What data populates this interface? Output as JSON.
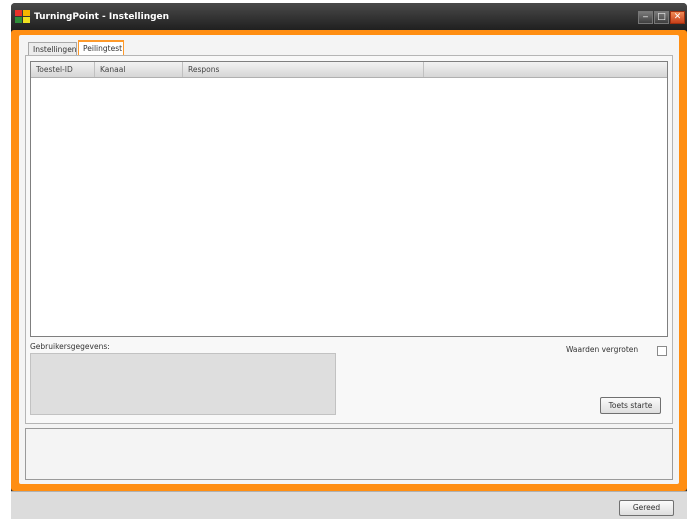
{
  "window": {
    "title": "TurningPoint - Instellingen",
    "controls": {
      "minimize": "‒",
      "maximize": "□",
      "close": "✕"
    }
  },
  "tabs": [
    {
      "label": "Instellingen",
      "active": false
    },
    {
      "label": "Peilingtest",
      "active": true
    }
  ],
  "list": {
    "columns": [
      "Toestel-ID",
      "Kanaal",
      "Respons",
      ""
    ],
    "rows": []
  },
  "gebruikersgegevens": {
    "label": "Gebruikersgegevens:"
  },
  "waarden_vergroten": {
    "label": "Waarden vergroten",
    "checked": false
  },
  "buttons": {
    "toets_starten": "Toets starte",
    "gereed": "Gereed"
  },
  "colors": {
    "accent": "#ff8e12",
    "titlebar": "#2a2a2a",
    "close": "#e05a25"
  }
}
